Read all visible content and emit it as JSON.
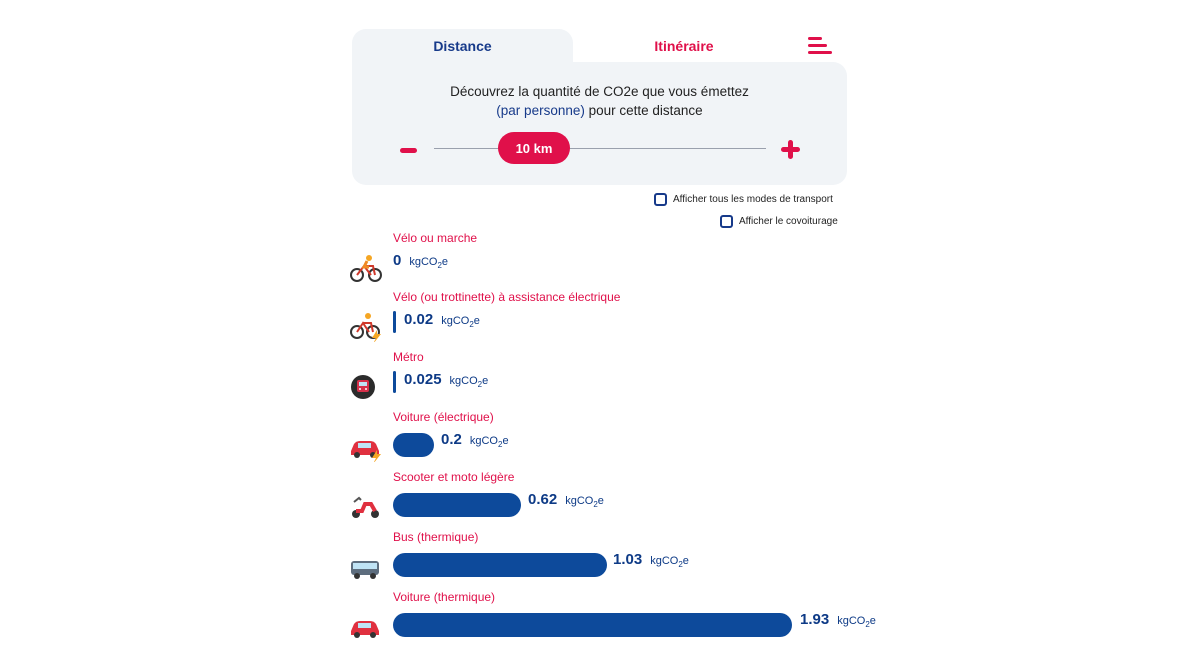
{
  "tabs": {
    "distance": "Distance",
    "itineraire": "Itinéraire"
  },
  "panel": {
    "line1": "Découvrez la quantité de CO2e que vous émettez",
    "line2_highlight": "(par personne)",
    "line2_rest": " pour cette distance",
    "slider_value": "10 km"
  },
  "options": {
    "all_modes": "Afficher tous les modes de transport",
    "carpool": "Afficher le covoiturage"
  },
  "unit": "kgCO",
  "unit_sub": "2",
  "unit_tail": "e",
  "colors": {
    "accent": "#e0104a",
    "bar": "#0d4a9b",
    "text_blue": "#173a8a"
  },
  "results": [
    {
      "label": "Vélo ou marche",
      "value": "0",
      "amount": 0,
      "icon": "bicycle-icon"
    },
    {
      "label": "Vélo (ou trottinette) à assistance électrique",
      "value": "0.02",
      "amount": 0.02,
      "icon": "electric-bike-icon"
    },
    {
      "label": "Métro",
      "value": "0.025",
      "amount": 0.025,
      "icon": "metro-icon"
    },
    {
      "label": "Voiture (électrique)",
      "value": "0.2",
      "amount": 0.2,
      "icon": "electric-car-icon"
    },
    {
      "label": "Scooter et moto légère",
      "value": "0.62",
      "amount": 0.62,
      "icon": "scooter-icon"
    },
    {
      "label": "Bus (thermique)",
      "value": "1.03",
      "amount": 1.03,
      "icon": "bus-icon"
    },
    {
      "label": "Voiture (thermique)",
      "value": "1.93",
      "amount": 1.93,
      "icon": "car-icon"
    }
  ]
}
